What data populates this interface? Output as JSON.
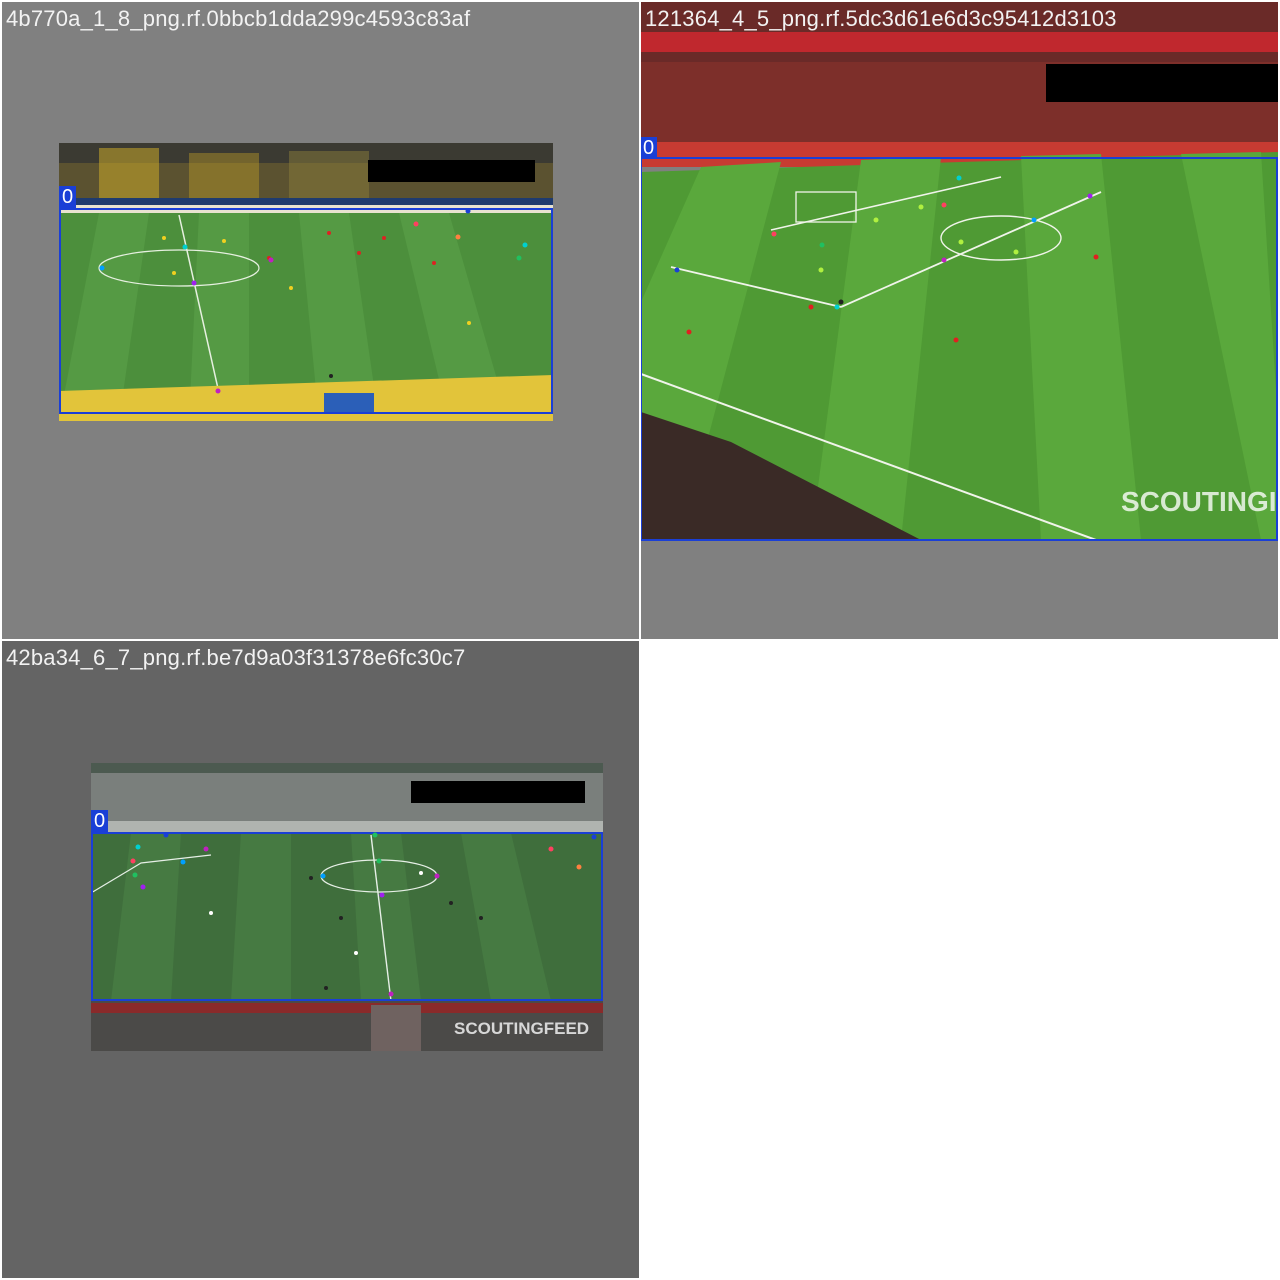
{
  "tiles": [
    {
      "title": "4b770a_1_8_png.rf.0bbcb1dda299c4593c83af",
      "box_label": "0"
    },
    {
      "title": "121364_4_5_png.rf.5dc3d61e6d3c95412d3103",
      "box_label": "0",
      "watermark": "SCOUTINGI"
    },
    {
      "title": "42ba34_6_7_png.rf.be7d9a03f31378e6fc30c7",
      "box_label": "0",
      "watermark": "SCOUTINGFEED"
    }
  ],
  "colors": {
    "tile1_bg": "#808080",
    "tile2_bg": "#808080",
    "tile3_bg": "#646464",
    "box": "#1a3fd6",
    "pitch_dark": "#3e7a32",
    "pitch_light": "#4a8c3a"
  },
  "keypoint_colors": [
    "#00d0d0",
    "#a020f0",
    "#20c060",
    "#ff4060",
    "#c020c0",
    "#ff8040",
    "#00a0ff",
    "#e040e0"
  ]
}
